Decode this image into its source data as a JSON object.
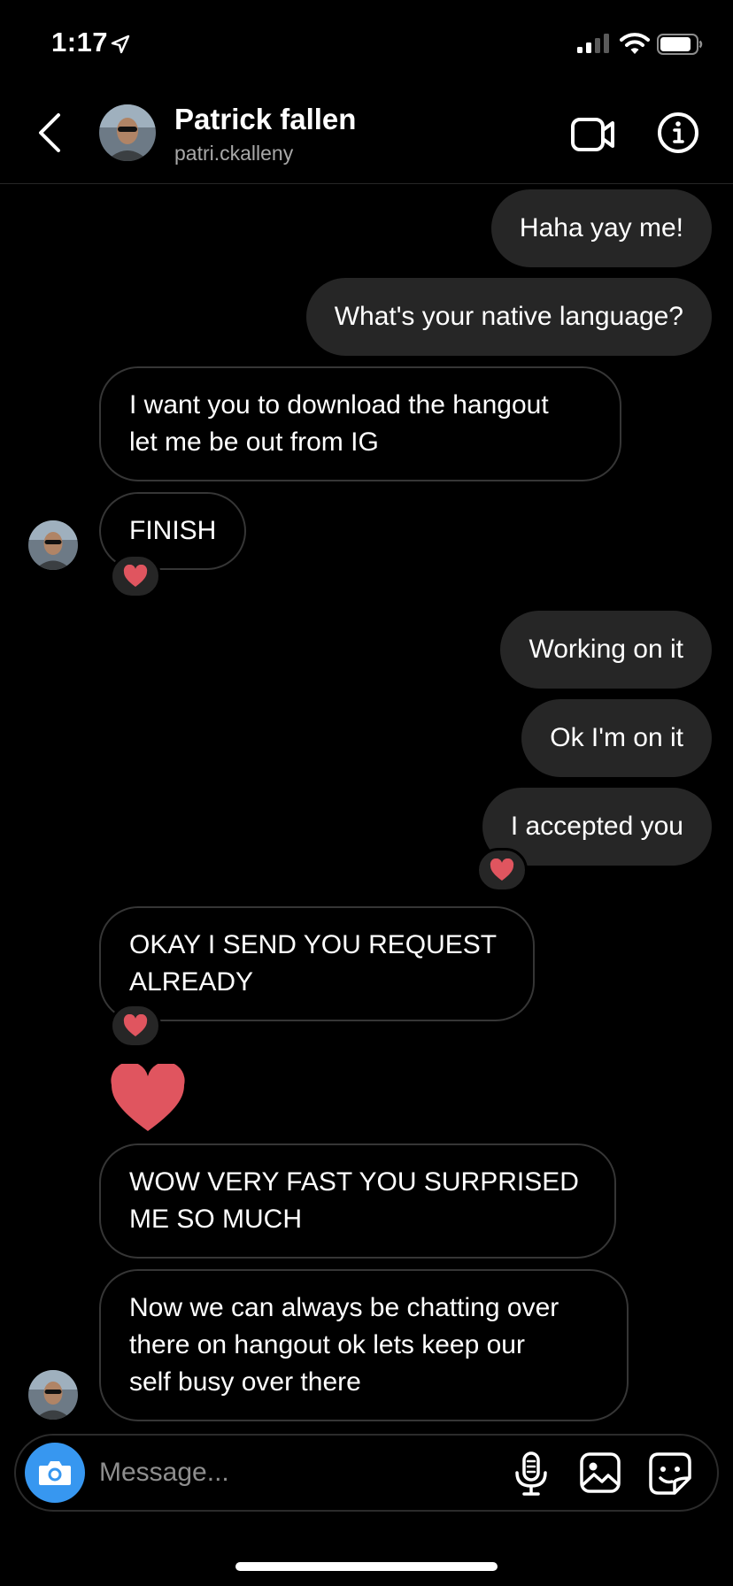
{
  "status_bar": {
    "time": "1:17"
  },
  "contact": {
    "name": "Patrick fallen",
    "handle": "patri.ckalleny"
  },
  "messages": [
    {
      "text": "Haha yay me!"
    },
    {
      "text": "What's your native language?"
    },
    {
      "text": "I want you to download the hangout\nlet me be out from IG"
    },
    {
      "text": "FINISH"
    },
    {
      "text": "Working on it"
    },
    {
      "text": "Ok I'm on it"
    },
    {
      "text": "I accepted you"
    },
    {
      "text": "OKAY I SEND YOU REQUEST\nALREADY"
    },
    {
      "text": "WOW VERY FAST YOU SURPRISED\nME SO MUCH"
    },
    {
      "text": "Now we can always be chatting over\nthere on hangout ok lets keep our\nself busy over there"
    }
  ],
  "composer": {
    "placeholder": "Message..."
  },
  "colors": {
    "outgoing_bubble": "#262626",
    "incoming_border": "#363636",
    "heart": "#e0555f",
    "camera": "#3797f0"
  }
}
